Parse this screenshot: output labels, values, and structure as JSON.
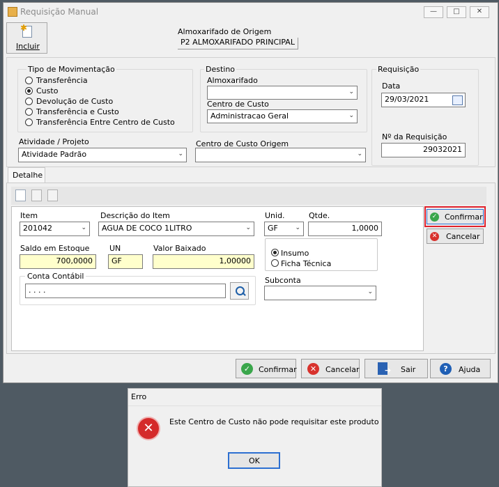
{
  "window": {
    "title": "Requisição Manual"
  },
  "toolbar": {
    "incluir_label": "Incluir"
  },
  "origem": {
    "label": "Almoxarifado de Origem",
    "value": "P2 ALMOXARIFADO PRINCIPAL"
  },
  "tipo": {
    "label": "Tipo de Movimentação",
    "options": [
      "Transferência",
      "Custo",
      "Devolução de Custo",
      "Transferência e Custo",
      "Transferência Entre Centro de Custo"
    ],
    "selected": "Custo"
  },
  "destino": {
    "label": "Destino",
    "almox_label": "Almoxarifado",
    "almox_value": "",
    "cc_label": "Centro de Custo",
    "cc_value": "Administracao Geral"
  },
  "requisicao": {
    "label": "Requisição",
    "data_label": "Data",
    "data_value": "29/03/2021",
    "num_label": "Nº  da Requisição",
    "num_value": "29032021"
  },
  "atividade": {
    "label": "Atividade / Projeto",
    "value": "Atividade Padrão"
  },
  "cc_origem": {
    "label": "Centro de Custo Origem",
    "value": ""
  },
  "tabs": {
    "detalhe": "Detalhe"
  },
  "item": {
    "item_label": "Item",
    "item_value": "201042",
    "desc_label": "Descrição do Item",
    "desc_value": "AGUA DE COCO 1LITRO",
    "unid_label": "Unid.",
    "unid_value": "GF",
    "qtde_label": "Qtde.",
    "qtde_value": "1,0000",
    "saldo_label": "Saldo em Estoque",
    "saldo_value": "700,0000",
    "un_label": "UN",
    "un_value": "GF",
    "valor_label": "Valor Baixado",
    "valor_value": "1,00000",
    "conta_label": "Conta Contábil",
    "conta_value": ". . . .",
    "insumo_label": "Insumo",
    "ficha_label": "Ficha Técnica",
    "subconta_label": "Subconta",
    "subconta_value": ""
  },
  "item_actions": {
    "confirmar": "Confirmar",
    "cancelar": "Cancelar"
  },
  "bottom": {
    "confirmar": "Confirmar",
    "cancelar": "Cancelar",
    "sair": "Sair",
    "ajuda": "Ajuda"
  },
  "dialog": {
    "title": "Erro",
    "message": "Este Centro de Custo não pode requisitar este produto",
    "ok": "OK"
  },
  "colors": {
    "confirm_highlight": "#e0212b",
    "ok_green": "#3aa64b",
    "cancel_red": "#d8322d",
    "help_blue": "#1f5fb5",
    "yellow_field": "#ffffcc"
  }
}
